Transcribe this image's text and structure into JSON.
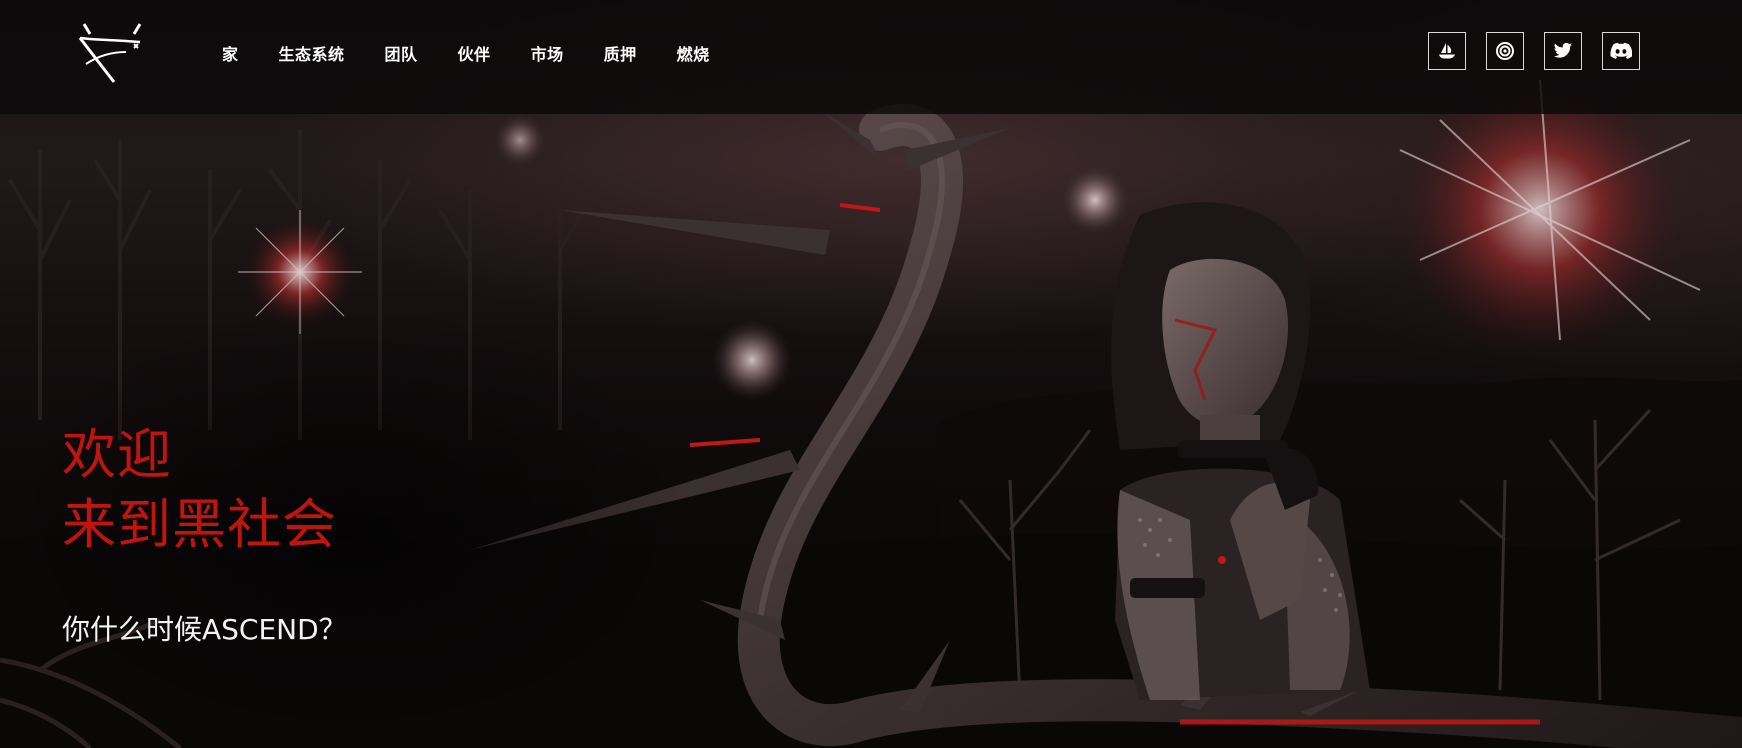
{
  "header": {
    "logo_name": "horned-x-logo",
    "nav": [
      {
        "label": "家"
      },
      {
        "label": "生态系统"
      },
      {
        "label": "团队"
      },
      {
        "label": "伙伴"
      },
      {
        "label": "市场"
      },
      {
        "label": "质押"
      },
      {
        "label": "燃烧"
      }
    ],
    "socials": [
      {
        "icon": "opensea-icon"
      },
      {
        "icon": "target-icon"
      },
      {
        "icon": "twitter-icon"
      },
      {
        "icon": "discord-icon"
      }
    ]
  },
  "hero": {
    "title_line1": "欢迎",
    "title_line2": "来到黑社会",
    "subtitle": "你什么时候ASCEND？"
  },
  "colors": {
    "accent_red": "#c0140f",
    "header_bg": "#0a0808",
    "text_white": "#ffffff"
  }
}
